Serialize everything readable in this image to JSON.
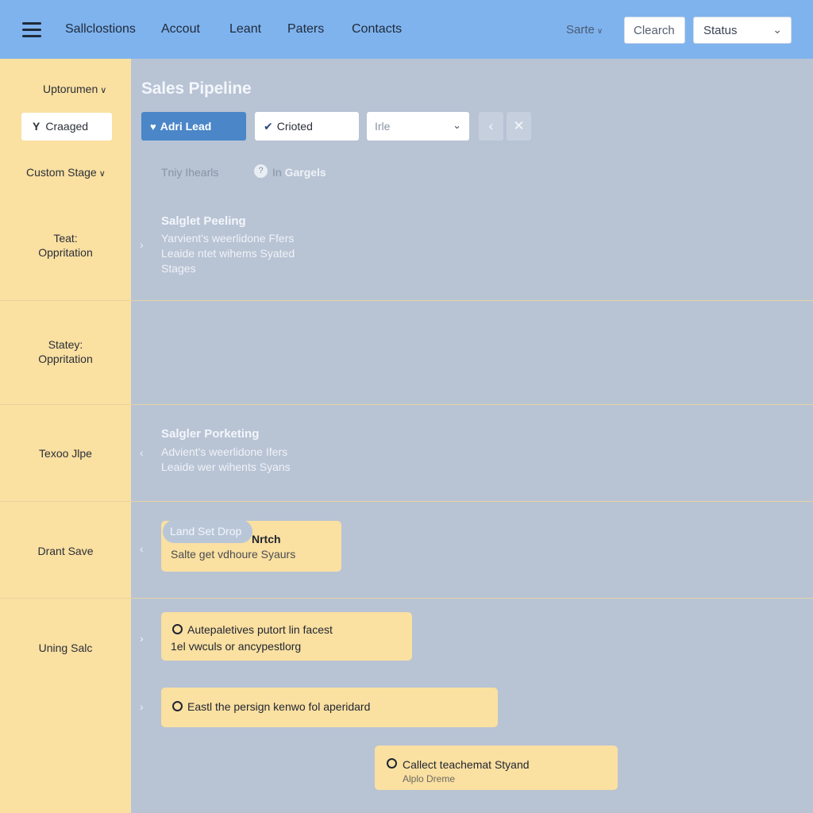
{
  "topbar": {
    "menu_icon": "hamburger-menu-icon",
    "nav": [
      "Sallclostions",
      "Accout",
      "Leant",
      "Paters",
      "Contacts"
    ],
    "sarte": "Sarte",
    "search": "Clearch",
    "status": "Status"
  },
  "sidebar": {
    "dropdown_top": "Uptorumen",
    "button": "Craaged",
    "button_icon": "filter-icon",
    "dropdown_stage": "Custom Stage",
    "stages": [
      {
        "line1": "Teat:",
        "line2": "Oppritation"
      },
      {
        "line1": "Statey:",
        "line2": "Oppritation"
      },
      {
        "line1": "Texoo Jlpe",
        "line2": ""
      },
      {
        "line1": "Drant Save",
        "line2": ""
      },
      {
        "line1": "Uning Salc",
        "line2": ""
      }
    ]
  },
  "main": {
    "title": "Sales Pipeline",
    "add_lead": "Adri Lead",
    "add_lead_icon": "heart-icon",
    "crioted": "Crioted",
    "crioted_icon": "checkmark-icon",
    "filter_select": "Irle",
    "back_icon": "chevron-left-icon",
    "close_icon": "close-icon",
    "meta_left": "Tniy Ihearls",
    "meta_right_prefix": "In",
    "meta_right": "Gargels"
  },
  "lanes": {
    "lane1": {
      "title": "Salglet Peeling",
      "lines": [
        "Yarvient's weerlidone Ffers",
        "Leaide ntet wihems Syated",
        "Stages"
      ]
    },
    "lane3": {
      "title": "Salgler Porketing",
      "lines": [
        "Advient's weerlidone Ifers",
        "Leaide wer wihents Syans"
      ]
    },
    "lane4_card": {
      "pill": "Land Set Drop",
      "title": "Nrtch",
      "sub": "Salte get vdhoure Syaurs"
    },
    "lane5_cards": [
      {
        "line1": "Autepaletives putort lin facest",
        "line2": "1el vwculs or ancypestlorg"
      },
      {
        "line1": "Eastl the persign kenwo fol aperidard"
      },
      {
        "line1": "Callect teachemat Styand",
        "sub": "Alplo Dreme"
      }
    ]
  },
  "colors": {
    "topbar": "#7fb3ee",
    "sidebar": "#fae0a1",
    "main_bg": "#b8c3d4",
    "primary": "#4a86c8"
  }
}
